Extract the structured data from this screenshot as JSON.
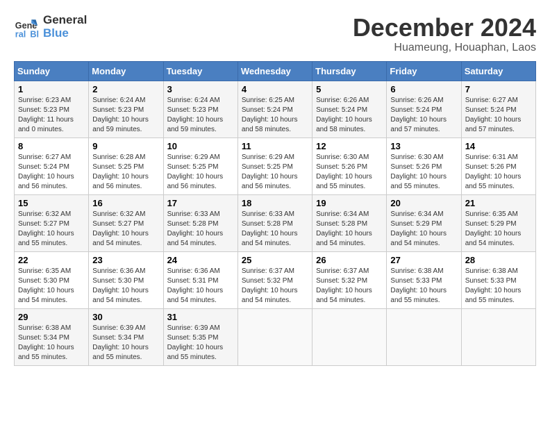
{
  "logo": {
    "line1": "General",
    "line2": "Blue"
  },
  "title": "December 2024",
  "subtitle": "Huameung, Houaphan, Laos",
  "days_of_week": [
    "Sunday",
    "Monday",
    "Tuesday",
    "Wednesday",
    "Thursday",
    "Friday",
    "Saturday"
  ],
  "weeks": [
    [
      {
        "day": "1",
        "info": "Sunrise: 6:23 AM\nSunset: 5:23 PM\nDaylight: 11 hours\nand 0 minutes."
      },
      {
        "day": "2",
        "info": "Sunrise: 6:24 AM\nSunset: 5:23 PM\nDaylight: 10 hours\nand 59 minutes."
      },
      {
        "day": "3",
        "info": "Sunrise: 6:24 AM\nSunset: 5:23 PM\nDaylight: 10 hours\nand 59 minutes."
      },
      {
        "day": "4",
        "info": "Sunrise: 6:25 AM\nSunset: 5:24 PM\nDaylight: 10 hours\nand 58 minutes."
      },
      {
        "day": "5",
        "info": "Sunrise: 6:26 AM\nSunset: 5:24 PM\nDaylight: 10 hours\nand 58 minutes."
      },
      {
        "day": "6",
        "info": "Sunrise: 6:26 AM\nSunset: 5:24 PM\nDaylight: 10 hours\nand 57 minutes."
      },
      {
        "day": "7",
        "info": "Sunrise: 6:27 AM\nSunset: 5:24 PM\nDaylight: 10 hours\nand 57 minutes."
      }
    ],
    [
      {
        "day": "8",
        "info": "Sunrise: 6:27 AM\nSunset: 5:24 PM\nDaylight: 10 hours\nand 56 minutes."
      },
      {
        "day": "9",
        "info": "Sunrise: 6:28 AM\nSunset: 5:25 PM\nDaylight: 10 hours\nand 56 minutes."
      },
      {
        "day": "10",
        "info": "Sunrise: 6:29 AM\nSunset: 5:25 PM\nDaylight: 10 hours\nand 56 minutes."
      },
      {
        "day": "11",
        "info": "Sunrise: 6:29 AM\nSunset: 5:25 PM\nDaylight: 10 hours\nand 56 minutes."
      },
      {
        "day": "12",
        "info": "Sunrise: 6:30 AM\nSunset: 5:26 PM\nDaylight: 10 hours\nand 55 minutes."
      },
      {
        "day": "13",
        "info": "Sunrise: 6:30 AM\nSunset: 5:26 PM\nDaylight: 10 hours\nand 55 minutes."
      },
      {
        "day": "14",
        "info": "Sunrise: 6:31 AM\nSunset: 5:26 PM\nDaylight: 10 hours\nand 55 minutes."
      }
    ],
    [
      {
        "day": "15",
        "info": "Sunrise: 6:32 AM\nSunset: 5:27 PM\nDaylight: 10 hours\nand 55 minutes."
      },
      {
        "day": "16",
        "info": "Sunrise: 6:32 AM\nSunset: 5:27 PM\nDaylight: 10 hours\nand 54 minutes."
      },
      {
        "day": "17",
        "info": "Sunrise: 6:33 AM\nSunset: 5:28 PM\nDaylight: 10 hours\nand 54 minutes."
      },
      {
        "day": "18",
        "info": "Sunrise: 6:33 AM\nSunset: 5:28 PM\nDaylight: 10 hours\nand 54 minutes."
      },
      {
        "day": "19",
        "info": "Sunrise: 6:34 AM\nSunset: 5:28 PM\nDaylight: 10 hours\nand 54 minutes."
      },
      {
        "day": "20",
        "info": "Sunrise: 6:34 AM\nSunset: 5:29 PM\nDaylight: 10 hours\nand 54 minutes."
      },
      {
        "day": "21",
        "info": "Sunrise: 6:35 AM\nSunset: 5:29 PM\nDaylight: 10 hours\nand 54 minutes."
      }
    ],
    [
      {
        "day": "22",
        "info": "Sunrise: 6:35 AM\nSunset: 5:30 PM\nDaylight: 10 hours\nand 54 minutes."
      },
      {
        "day": "23",
        "info": "Sunrise: 6:36 AM\nSunset: 5:30 PM\nDaylight: 10 hours\nand 54 minutes."
      },
      {
        "day": "24",
        "info": "Sunrise: 6:36 AM\nSunset: 5:31 PM\nDaylight: 10 hours\nand 54 minutes."
      },
      {
        "day": "25",
        "info": "Sunrise: 6:37 AM\nSunset: 5:32 PM\nDaylight: 10 hours\nand 54 minutes."
      },
      {
        "day": "26",
        "info": "Sunrise: 6:37 AM\nSunset: 5:32 PM\nDaylight: 10 hours\nand 54 minutes."
      },
      {
        "day": "27",
        "info": "Sunrise: 6:38 AM\nSunset: 5:33 PM\nDaylight: 10 hours\nand 55 minutes."
      },
      {
        "day": "28",
        "info": "Sunrise: 6:38 AM\nSunset: 5:33 PM\nDaylight: 10 hours\nand 55 minutes."
      }
    ],
    [
      {
        "day": "29",
        "info": "Sunrise: 6:38 AM\nSunset: 5:34 PM\nDaylight: 10 hours\nand 55 minutes."
      },
      {
        "day": "30",
        "info": "Sunrise: 6:39 AM\nSunset: 5:34 PM\nDaylight: 10 hours\nand 55 minutes."
      },
      {
        "day": "31",
        "info": "Sunrise: 6:39 AM\nSunset: 5:35 PM\nDaylight: 10 hours\nand 55 minutes."
      },
      {
        "day": "",
        "info": ""
      },
      {
        "day": "",
        "info": ""
      },
      {
        "day": "",
        "info": ""
      },
      {
        "day": "",
        "info": ""
      }
    ]
  ]
}
